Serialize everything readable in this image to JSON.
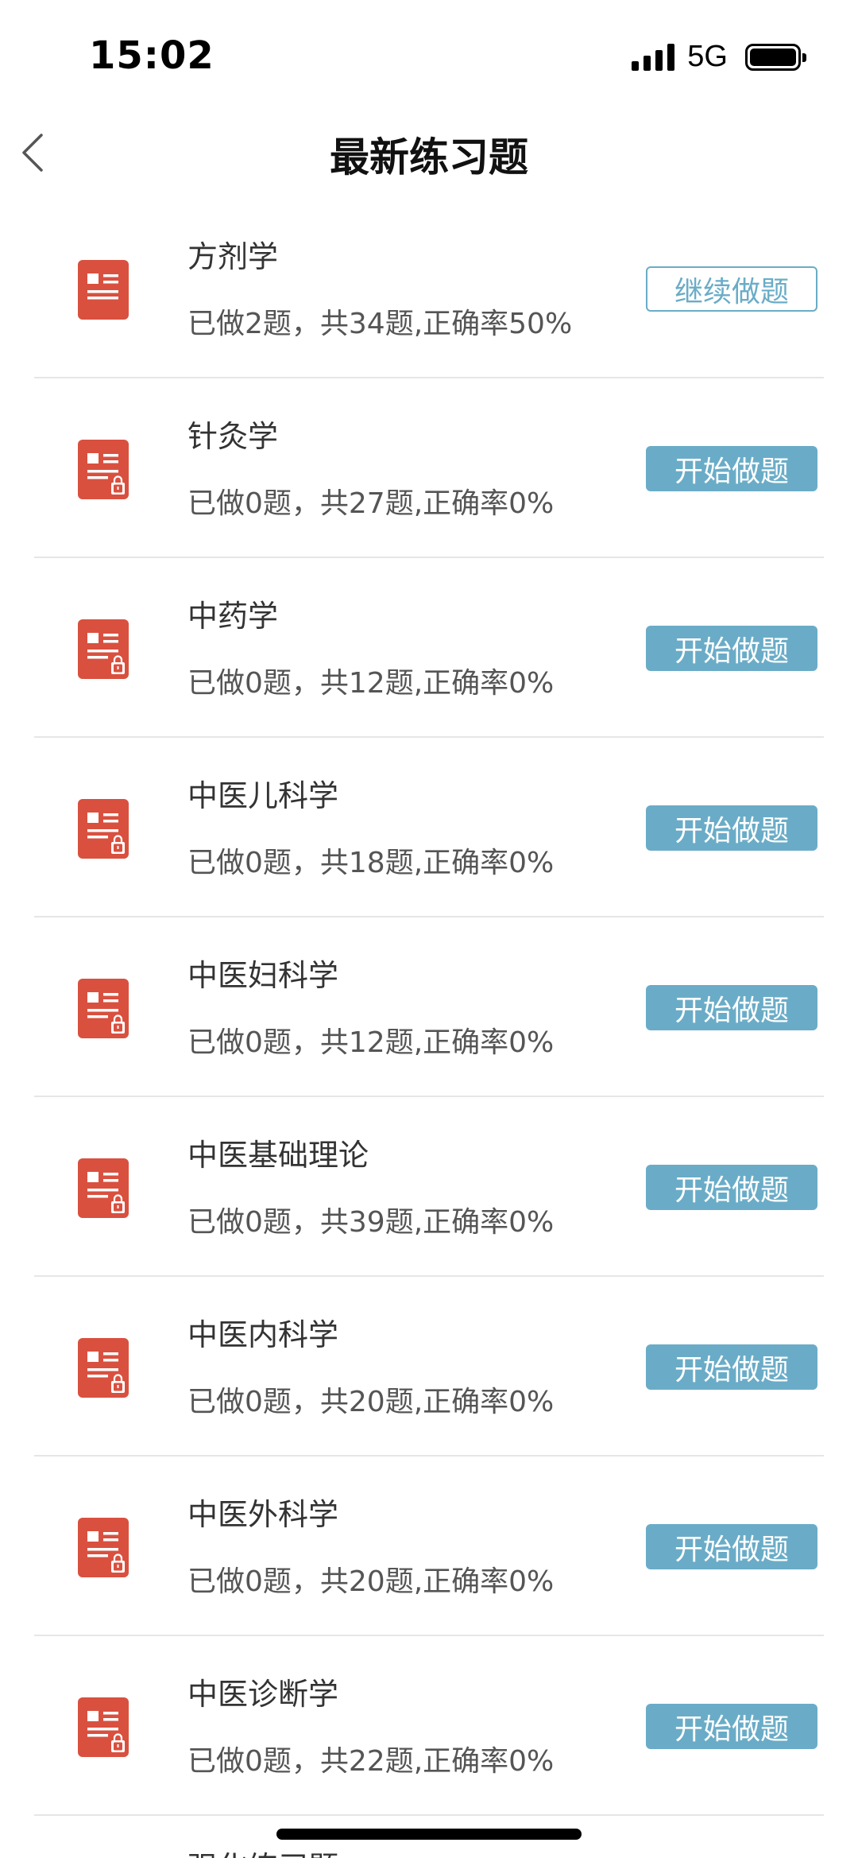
{
  "status_bar": {
    "time": "15:02",
    "network": "5G"
  },
  "nav": {
    "title": "最新练习题"
  },
  "colors": {
    "accent": "#6aacc7",
    "icon_red": "#d9503f"
  },
  "items": [
    {
      "title": "方剂学",
      "stats": "已做2题，共34题,正确率50%",
      "button": "继续做题",
      "button_style": "continue",
      "locked": false
    },
    {
      "title": "针灸学",
      "stats": "已做0题，共27题,正确率0%",
      "button": "开始做题",
      "button_style": "start",
      "locked": true
    },
    {
      "title": "中药学",
      "stats": "已做0题，共12题,正确率0%",
      "button": "开始做题",
      "button_style": "start",
      "locked": true
    },
    {
      "title": "中医儿科学",
      "stats": "已做0题，共18题,正确率0%",
      "button": "开始做题",
      "button_style": "start",
      "locked": true
    },
    {
      "title": "中医妇科学",
      "stats": "已做0题，共12题,正确率0%",
      "button": "开始做题",
      "button_style": "start",
      "locked": true
    },
    {
      "title": "中医基础理论",
      "stats": "已做0题，共39题,正确率0%",
      "button": "开始做题",
      "button_style": "start",
      "locked": true
    },
    {
      "title": "中医内科学",
      "stats": "已做0题，共20题,正确率0%",
      "button": "开始做题",
      "button_style": "start",
      "locked": true
    },
    {
      "title": "中医外科学",
      "stats": "已做0题，共20题,正确率0%",
      "button": "开始做题",
      "button_style": "start",
      "locked": true
    },
    {
      "title": "中医诊断学",
      "stats": "已做0题，共22题,正确率0%",
      "button": "开始做题",
      "button_style": "start",
      "locked": true
    }
  ],
  "partial_item": {
    "title": "强化练习题"
  }
}
